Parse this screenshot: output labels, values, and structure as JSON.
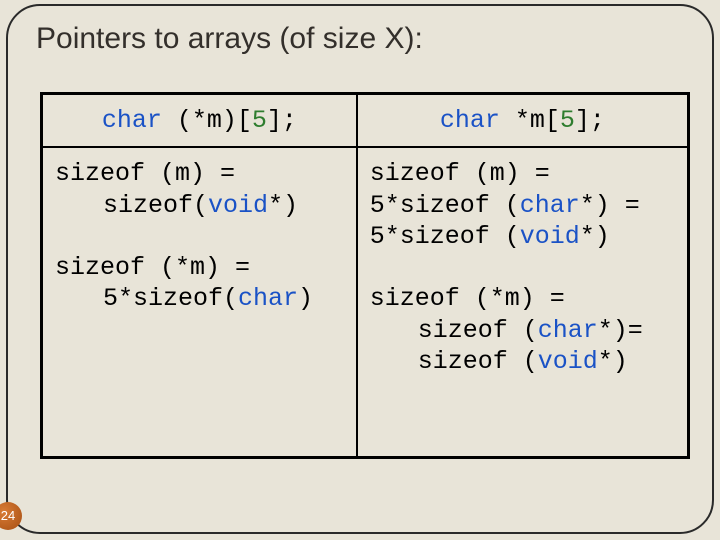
{
  "title": "Pointers to arrays (of size X):",
  "table": {
    "header": {
      "left": {
        "kw": "char",
        "rest": " (*m)[",
        "num": "5",
        "tail": "];"
      },
      "right": {
        "kw": "char",
        "rest": " *m[",
        "num": "5",
        "tail": "];"
      }
    },
    "body": {
      "left": {
        "l1": "sizeof (m) =",
        "l2": "sizeof(",
        "l2kw": "void",
        "l2tail": "*)",
        "l3": "",
        "l4": "sizeof (*m) =",
        "l5": "5*sizeof(",
        "l5kw": "char",
        "l5tail": ")"
      },
      "right": {
        "r1": "sizeof (m) =",
        "r2": "5*sizeof (",
        "r2kw": "char",
        "r2tail": "*) =",
        "r3": "5*sizeof (",
        "r3kw": "void",
        "r3tail": "*)",
        "r4": "",
        "r5": "sizeof (*m) =",
        "r6": "sizeof (",
        "r6kw": "char",
        "r6tail": "*)=",
        "r7": "sizeof (",
        "r7kw": "void",
        "r7tail": "*)"
      }
    }
  },
  "page_number": "24"
}
